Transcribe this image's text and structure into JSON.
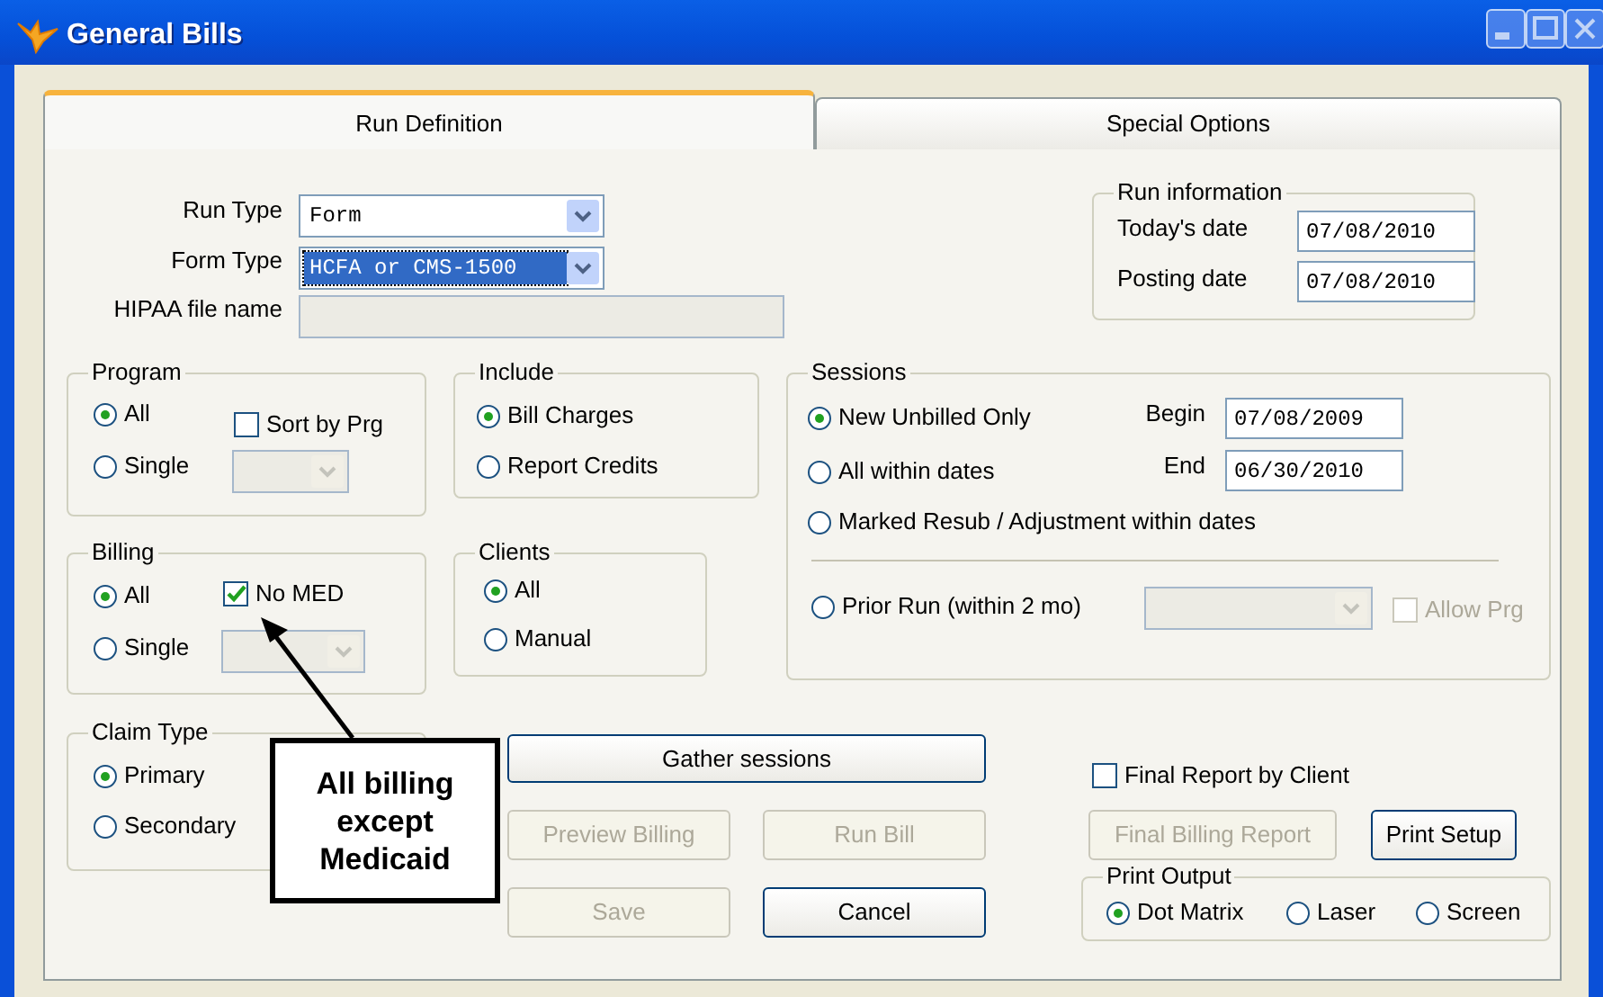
{
  "window": {
    "title": "General Bills"
  },
  "tabs": [
    {
      "label": "Run Definition",
      "selected": true
    },
    {
      "label": "Special Options",
      "selected": false
    }
  ],
  "run_type": {
    "label": "Run Type",
    "value": "Form",
    "focused": false
  },
  "form_type": {
    "label": "Form Type",
    "value": "HCFA or CMS-1500",
    "focused": true
  },
  "hipaa_file_name": {
    "label": "HIPAA file name",
    "disabled": true
  },
  "run_information": {
    "title": "Run information",
    "fields": [
      {
        "label": "Today's date",
        "value": "07/08/2010"
      },
      {
        "label": "Posting date",
        "value": "07/08/2010"
      }
    ]
  },
  "program": {
    "title": "Program",
    "options": [
      {
        "label": "All",
        "selected": true
      },
      {
        "label": "Single",
        "selected": false
      }
    ],
    "sort_by_prg": {
      "label": "Sort by Prg",
      "checked": false
    },
    "dropdown": {
      "disabled": true
    }
  },
  "include": {
    "title": "Include",
    "options": [
      {
        "label": "Bill Charges",
        "selected": true
      },
      {
        "label": "Report Credits",
        "selected": false
      }
    ]
  },
  "sessions": {
    "title": "Sessions",
    "options": [
      {
        "label": "New Unbilled Only",
        "selected": true
      },
      {
        "label": "All within dates",
        "selected": false
      },
      {
        "label": "Marked Resub / Adjustment within dates",
        "selected": false
      },
      {
        "label": "Prior Run (within 2 mo)",
        "selected": false
      }
    ],
    "dates": [
      {
        "label": "Begin",
        "value": "07/08/2009"
      },
      {
        "label": "End",
        "value": "06/30/2010"
      }
    ],
    "prior_run_dropdown": {
      "disabled": true
    },
    "allow_prg": {
      "label": "Allow Prg",
      "checked": false,
      "disabled": true
    }
  },
  "billing": {
    "title": "Billing",
    "options": [
      {
        "label": "All",
        "selected": true
      },
      {
        "label": "Single",
        "selected": false
      }
    ],
    "no_med": {
      "label": "No MED",
      "checked": true
    },
    "dropdown": {
      "disabled": true
    }
  },
  "clients": {
    "title": "Clients",
    "options": [
      {
        "label": "All",
        "selected": true
      },
      {
        "label": "Manual",
        "selected": false
      }
    ]
  },
  "claim_type": {
    "title": "Claim Type",
    "options": [
      {
        "label": "Primary",
        "selected": true
      },
      {
        "label": "Secondary",
        "selected": false
      }
    ]
  },
  "buttons": [
    {
      "label": "Gather sessions",
      "disabled": false
    },
    {
      "label": "Preview Billing",
      "disabled": true
    },
    {
      "label": "Run Bill",
      "disabled": true
    },
    {
      "label": "Save",
      "disabled": true
    },
    {
      "label": "Cancel",
      "disabled": false
    }
  ],
  "final_report_by_client": {
    "label": "Final Report by Client",
    "checked": false
  },
  "report_buttons": [
    {
      "label": "Final Billing Report",
      "disabled": true
    },
    {
      "label": "Print Setup",
      "disabled": false
    }
  ],
  "print_output": {
    "title": "Print Output",
    "options": [
      {
        "label": "Dot Matrix",
        "selected": true
      },
      {
        "label": "Laser",
        "selected": false
      },
      {
        "label": "Screen",
        "selected": false
      }
    ]
  },
  "callout": {
    "text": "All billing except Medicaid"
  }
}
